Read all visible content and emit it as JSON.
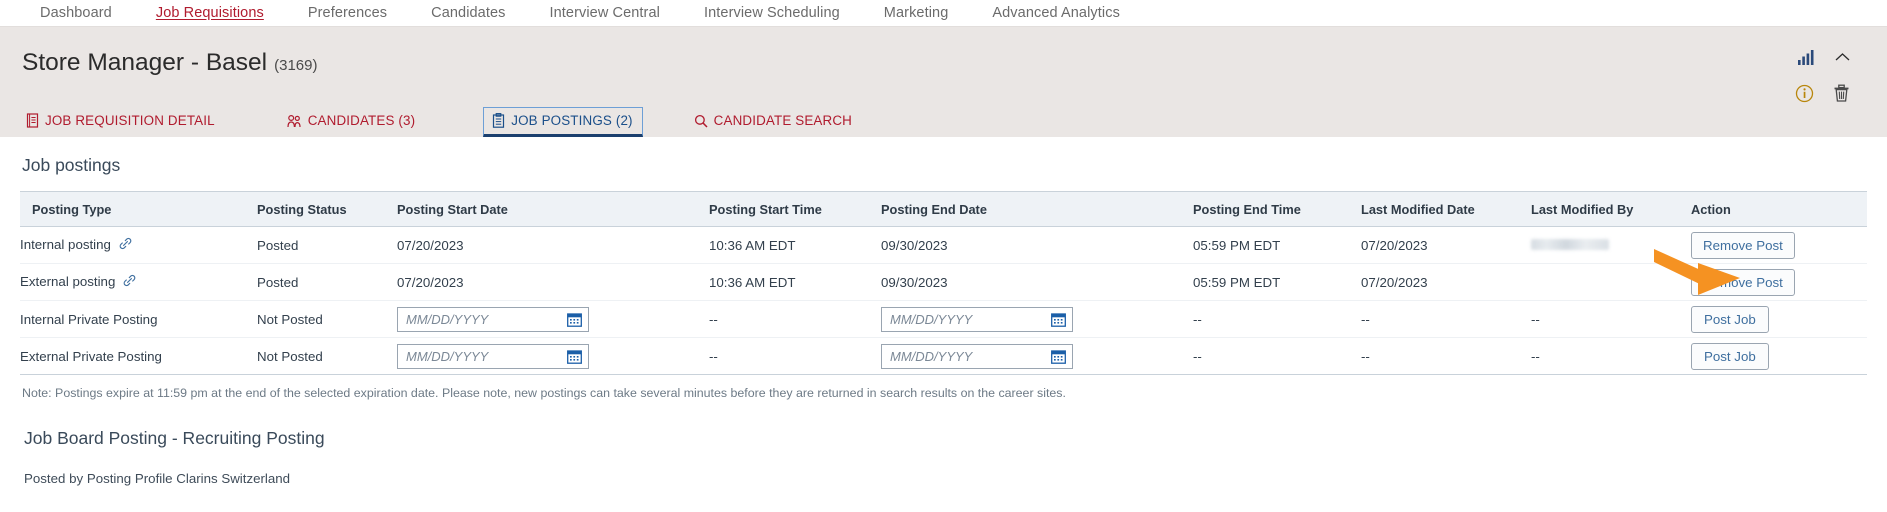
{
  "topnav": {
    "items": [
      {
        "label": "Dashboard",
        "active": false
      },
      {
        "label": "Job Requisitions",
        "active": true
      },
      {
        "label": "Preferences",
        "active": false
      },
      {
        "label": "Candidates",
        "active": false
      },
      {
        "label": "Interview Central",
        "active": false
      },
      {
        "label": "Interview Scheduling",
        "active": false
      },
      {
        "label": "Marketing",
        "active": false
      },
      {
        "label": "Advanced Analytics",
        "active": false
      }
    ]
  },
  "header": {
    "title": "Store Manager - Basel",
    "req_id": "(3169)",
    "icons": {
      "chart": "bar-chart-icon",
      "collapse": "chevron-up-icon",
      "info": "info-icon",
      "delete": "trash-icon"
    }
  },
  "subtabs": [
    {
      "label": "JOB REQUISITION DETAIL",
      "icon": "document-icon",
      "active": false
    },
    {
      "label": "CANDIDATES (3)",
      "icon": "people-icon",
      "active": false
    },
    {
      "label": "JOB POSTINGS (2)",
      "icon": "clipboard-icon",
      "active": true
    },
    {
      "label": "CANDIDATE SEARCH",
      "icon": "search-icon",
      "active": false
    }
  ],
  "main": {
    "section_title": "Job postings",
    "note": "Note: Postings expire at 11:59 pm at the end of the selected expiration date. Please note, new postings can take several minutes before they are returned in search results on the career sites.",
    "board_title": "Job Board Posting - Recruiting Posting",
    "board_subtitle": "Posted by Posting Profile Clarins Switzerland"
  },
  "table": {
    "columns": [
      "Posting Type",
      "Posting Status",
      "Posting Start Date",
      "Posting Start Time",
      "Posting End Date",
      "Posting End Time",
      "Last Modified Date",
      "Last Modified By",
      "Action"
    ],
    "rows": [
      {
        "type": "Internal posting",
        "has_link_icon": true,
        "status": "Posted",
        "start_date": "07/20/2023",
        "start_time": "10:36 AM EDT",
        "end_date": "09/30/2023",
        "end_time": "05:59 PM EDT",
        "last_modified_date": "07/20/2023",
        "last_modified_by": "",
        "last_modified_by_redacted": true,
        "action_label": "Remove Post",
        "editable_dates": false
      },
      {
        "type": "External posting",
        "has_link_icon": true,
        "status": "Posted",
        "start_date": "07/20/2023",
        "start_time": "10:36 AM EDT",
        "end_date": "09/30/2023",
        "end_time": "05:59 PM EDT",
        "last_modified_date": "07/20/2023",
        "last_modified_by": "",
        "last_modified_by_redacted": false,
        "action_label": "Remove Post",
        "editable_dates": false
      },
      {
        "type": "Internal Private Posting",
        "has_link_icon": false,
        "status": "Not Posted",
        "start_date": "",
        "start_date_placeholder": "MM/DD/YYYY",
        "start_time": "--",
        "end_date": "",
        "end_date_placeholder": "MM/DD/YYYY",
        "end_time": "--",
        "last_modified_date": "--",
        "last_modified_by": "--",
        "last_modified_by_redacted": false,
        "action_label": "Post Job",
        "editable_dates": true
      },
      {
        "type": "External Private Posting",
        "has_link_icon": false,
        "status": "Not Posted",
        "start_date": "",
        "start_date_placeholder": "MM/DD/YYYY",
        "start_time": "--",
        "end_date": "",
        "end_date_placeholder": "MM/DD/YYYY",
        "end_time": "--",
        "last_modified_date": "--",
        "last_modified_by": "--",
        "last_modified_by_redacted": false,
        "action_label": "Post Job",
        "editable_dates": true
      }
    ]
  },
  "annotation": {
    "type": "arrow",
    "color": "#f59222",
    "points_to": "Remove Post button of External posting row"
  }
}
